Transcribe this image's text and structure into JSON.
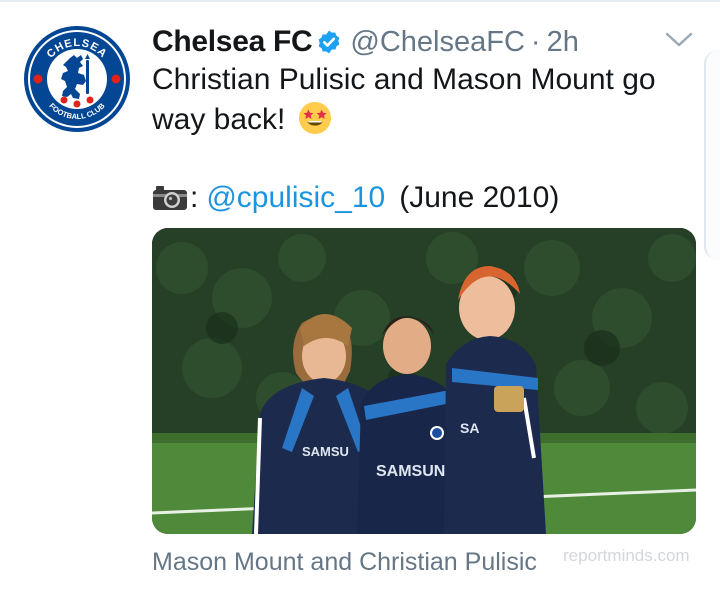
{
  "tweet": {
    "display_name": "Chelsea FC",
    "handle": "@ChelseaFC",
    "separator": "·",
    "time": "2h",
    "text_line1": "Christian Pulisic and Mason Mount go",
    "text_line2": "way back!",
    "emoji": "star-struck-emoji",
    "credit_prefix": ":",
    "credit_mention": "@cpulisic_10",
    "credit_date": "(June 2010)",
    "photo_caption": "Mason Mount and Christian Pulisic"
  },
  "avatar": {
    "crest_top_text": "CHELSEA",
    "crest_bottom_text": "FOOTBALL CLUB"
  },
  "watermark": "reportminds.com",
  "icons": {
    "verified": "verified-badge-icon",
    "menu": "chevron-down-icon",
    "camera": "camera-icon"
  },
  "colors": {
    "link": "#1b95e0",
    "secondary_text": "#657786",
    "primary_text": "#14171a",
    "crest_blue": "#034694"
  }
}
